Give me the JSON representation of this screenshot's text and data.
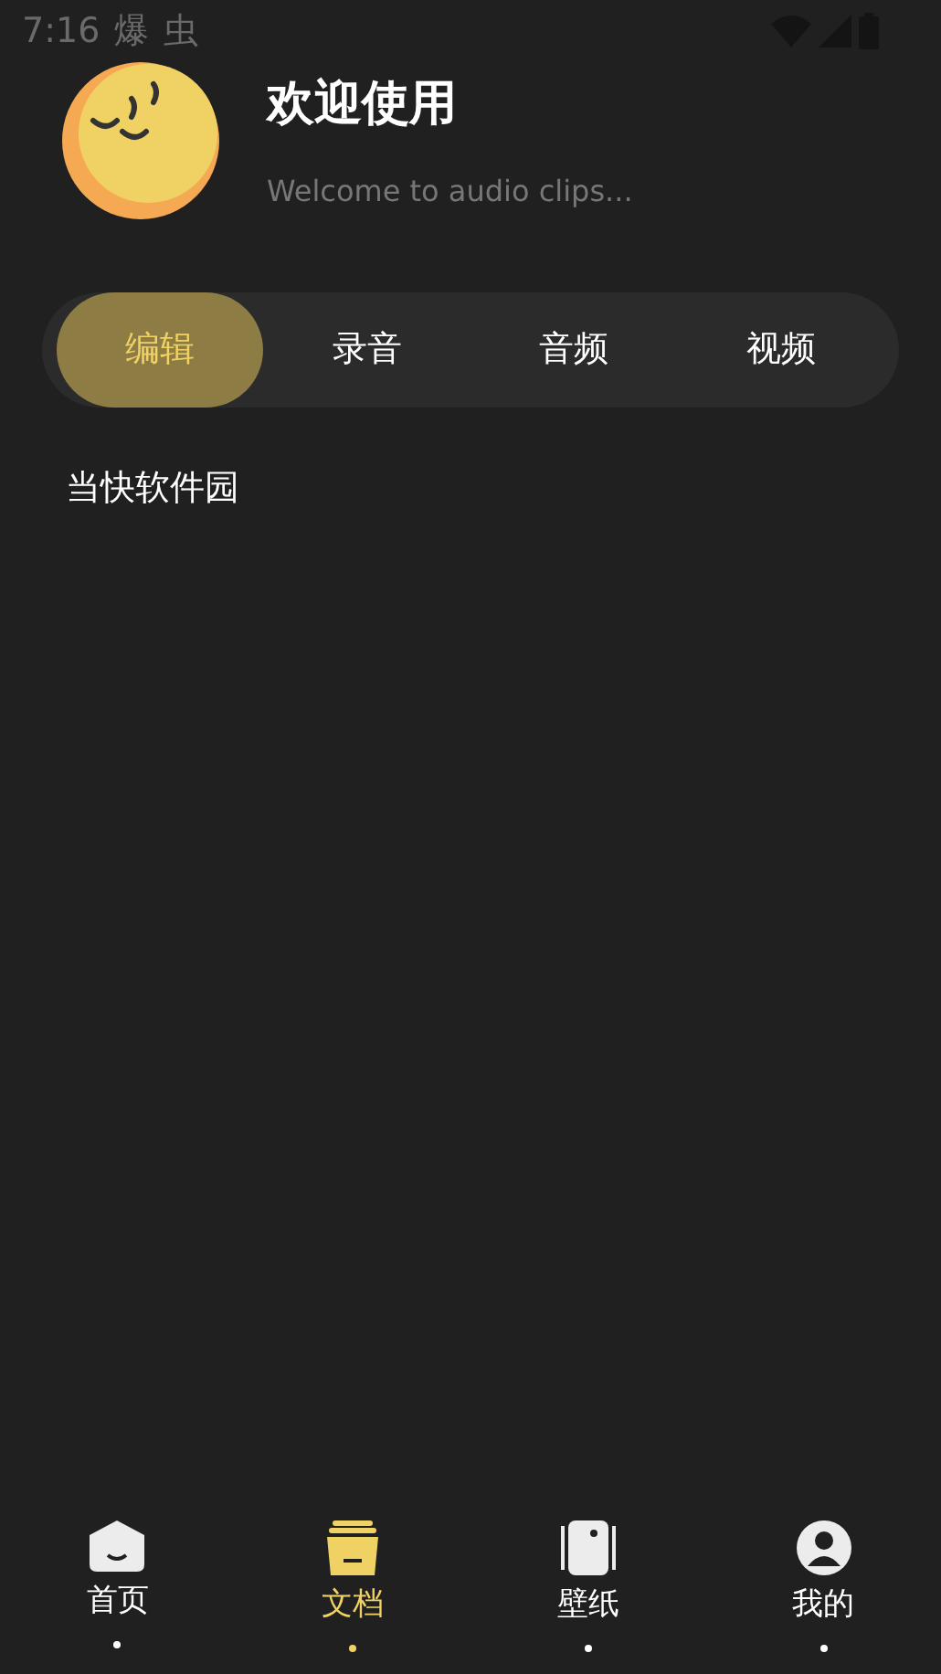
{
  "status_bar": {
    "time": "7:16",
    "notices": [
      "爆",
      "虫"
    ]
  },
  "header": {
    "title": "欢迎使用",
    "subtitle": "Welcome to audio clips..."
  },
  "tabs": [
    {
      "label": "编辑",
      "selected": true
    },
    {
      "label": "录音",
      "selected": false
    },
    {
      "label": "音频",
      "selected": false
    },
    {
      "label": "视频",
      "selected": false
    }
  ],
  "items": [
    {
      "title": "当快软件园"
    }
  ],
  "bottom_nav": [
    {
      "label": "首页",
      "kind": "home",
      "selected": false
    },
    {
      "label": "文档",
      "kind": "docs",
      "selected": true
    },
    {
      "label": "壁纸",
      "kind": "wallpaper",
      "selected": false
    },
    {
      "label": "我的",
      "kind": "profile",
      "selected": false
    }
  ]
}
